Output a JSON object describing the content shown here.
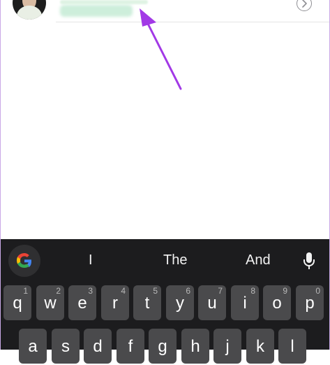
{
  "contact": {
    "avatar_icon": "profile-photo",
    "chevron_icon": "chevron-right-circle-icon"
  },
  "annotation": {
    "arrow_color": "#a239e6"
  },
  "keyboard": {
    "logo_icon": "google-g-icon",
    "suggestions": [
      "I",
      "The",
      "And"
    ],
    "mic_icon": "microphone-icon",
    "row1": [
      {
        "key": "q",
        "num": "1"
      },
      {
        "key": "w",
        "num": "2"
      },
      {
        "key": "e",
        "num": "3"
      },
      {
        "key": "r",
        "num": "4"
      },
      {
        "key": "t",
        "num": "5"
      },
      {
        "key": "y",
        "num": "6"
      },
      {
        "key": "u",
        "num": "7"
      },
      {
        "key": "i",
        "num": "8"
      },
      {
        "key": "o",
        "num": "9"
      },
      {
        "key": "p",
        "num": "0"
      }
    ],
    "row2": [
      "a",
      "s",
      "d",
      "f",
      "g",
      "h",
      "j",
      "k",
      "l"
    ]
  }
}
